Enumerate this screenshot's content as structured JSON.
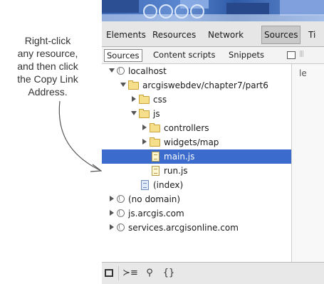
{
  "callout": {
    "line1": "Right-click",
    "line2": "any resource,",
    "line3": "and then click",
    "line4": "the Copy Link",
    "line5": "Address."
  },
  "main_tabs": [
    "Elements",
    "Resources",
    "Network",
    "Sources",
    "Ti"
  ],
  "active_main_tab": "Sources",
  "sub_tabs": [
    "Sources",
    "Content scripts",
    "Snippets"
  ],
  "active_sub_tab": "Sources",
  "right_pane_text": "le",
  "tree": [
    {
      "label": "localhost",
      "icon": "globe-icon",
      "expanded": true,
      "level": 0
    },
    {
      "label": "arcgiswebdev/chapter7/part6",
      "icon": "folder-icon",
      "expanded": true,
      "level": 1
    },
    {
      "label": "css",
      "icon": "folder-icon",
      "expanded": false,
      "level": 2
    },
    {
      "label": "js",
      "icon": "folder-icon",
      "expanded": true,
      "level": 2
    },
    {
      "label": "controllers",
      "icon": "folder-icon",
      "expanded": false,
      "level": 3
    },
    {
      "label": "widgets/map",
      "icon": "folder-icon",
      "expanded": false,
      "level": 3
    },
    {
      "label": "main.js",
      "icon": "script-file-icon",
      "selected": true,
      "level": 3
    },
    {
      "label": "run.js",
      "icon": "script-file-icon",
      "level": 3
    },
    {
      "label": "(index)",
      "icon": "document-file-icon",
      "level": 2
    },
    {
      "label": "(no domain)",
      "icon": "globe-icon",
      "expanded": false,
      "level": 0
    },
    {
      "label": "js.arcgis.com",
      "icon": "globe-icon",
      "expanded": false,
      "level": 0
    },
    {
      "label": "services.arcgisonline.com",
      "icon": "globe-icon",
      "expanded": false,
      "level": 0
    }
  ],
  "toolbar": {
    "console_glyph": "≻≡",
    "search_glyph": "⚲",
    "format_glyph": "{}"
  },
  "colors": {
    "selection": "#3a6bcd",
    "banner": "#3e69b8",
    "folder": "#f6df8a"
  }
}
